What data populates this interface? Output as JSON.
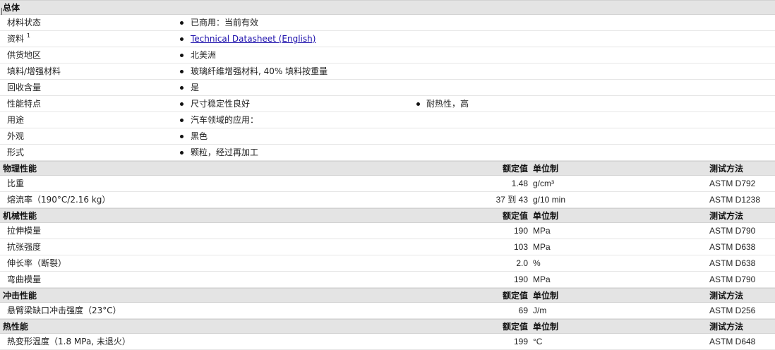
{
  "general": {
    "title": "总体",
    "rows": [
      {
        "label": "材料状态",
        "col1": "已商用：当前有效"
      },
      {
        "label": "资料",
        "sup": "1",
        "col1": "Technical Datasheet (English)"
      },
      {
        "label": "供货地区",
        "col1": "北美洲"
      },
      {
        "label": "填料/增强材料",
        "col1": "玻璃纤维增强材料, 40% 填料按重量"
      },
      {
        "label": "回收含量",
        "col1": "是"
      },
      {
        "label": "性能特点",
        "col1": "尺寸稳定性良好",
        "col2": "耐热性，高"
      },
      {
        "label": "用途",
        "col1": "汽车领域的应用："
      },
      {
        "label": "外观",
        "col1": "黑色"
      },
      {
        "label": "形式",
        "col1": "颗粒，经过再加工"
      }
    ]
  },
  "columns": {
    "nominal": "额定值",
    "unit": "单位制",
    "test": "测试方法"
  },
  "physical": {
    "title": "物理性能",
    "rows": [
      {
        "label": "比重",
        "value": "1.48",
        "unit": "g/cm³",
        "test": "ASTM D792"
      },
      {
        "label": "熔流率（190°C/2.16 kg）",
        "value": "37 到 43",
        "unit": "g/10 min",
        "test": "ASTM D1238"
      }
    ]
  },
  "mechanical": {
    "title": "机械性能",
    "rows": [
      {
        "label": "拉伸模量",
        "value": "190",
        "unit": "MPa",
        "test": "ASTM D790"
      },
      {
        "label": "抗张强度",
        "value": "103",
        "unit": "MPa",
        "test": "ASTM D638"
      },
      {
        "label": "伸长率（断裂）",
        "value": "2.0",
        "unit": "%",
        "test": "ASTM D638"
      },
      {
        "label": "弯曲模量",
        "value": "190",
        "unit": "MPa",
        "test": "ASTM D790"
      }
    ]
  },
  "impact": {
    "title": "冲击性能",
    "rows": [
      {
        "label": "悬臂梁缺口冲击强度（23°C）",
        "value": "69",
        "unit": "J/m",
        "test": "ASTM D256"
      }
    ]
  },
  "thermal": {
    "title": "热性能",
    "rows": [
      {
        "label": "热变形温度（1.8 MPa, 未退火）",
        "value": "199",
        "unit": "°C",
        "test": "ASTM D648"
      }
    ]
  }
}
